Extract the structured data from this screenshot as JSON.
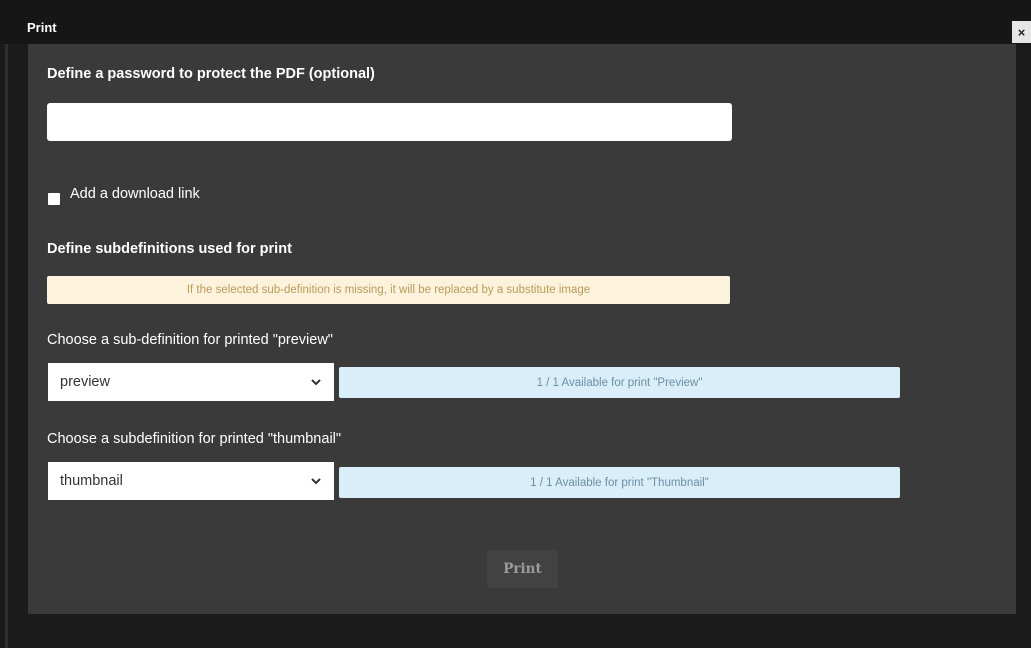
{
  "dialog": {
    "title": "Print",
    "close_glyph": "×"
  },
  "password": {
    "label": "Define a password to protect the PDF (optional)",
    "value": "",
    "placeholder": ""
  },
  "download_link": {
    "label": "Add a download link",
    "checked": false
  },
  "subdefinitions": {
    "heading": "Define subdefinitions used for print",
    "warning": "If the selected sub-definition is missing, it will be replaced by a substitute image"
  },
  "preview": {
    "label": "Choose a sub-definition for printed \"preview\"",
    "selected": "preview",
    "availability": "1 / 1 Available for print \"Preview\""
  },
  "thumbnail": {
    "label": "Choose a subdefinition for printed \"thumbnail\"",
    "selected": "thumbnail",
    "availability": "1 / 1 Available for print \"Thumbnail\""
  },
  "actions": {
    "print_label": "Print"
  },
  "icons": {
    "close": "close-icon",
    "dropdown": "chevron-down-icon",
    "checkbox": "checkbox-icon"
  },
  "colors": {
    "background": "#1b1b1b",
    "panel": "#3a3a3a",
    "warning_bg": "#fdf3dd",
    "warning_text": "#b99a58",
    "info_bg": "#d9eef8",
    "info_text": "#6b8fa6"
  }
}
